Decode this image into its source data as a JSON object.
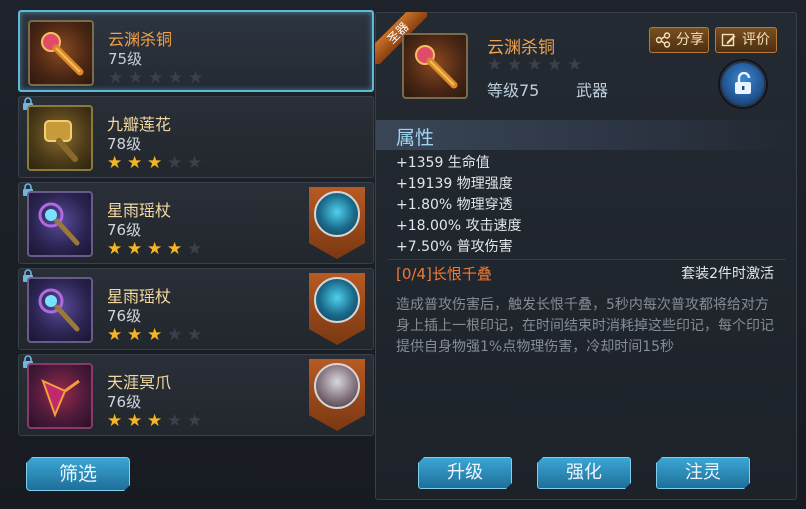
{
  "items": [
    {
      "name": "云渊杀铜",
      "level": "75级",
      "stars": 0,
      "selected": true,
      "badge": null
    },
    {
      "name": "九瓣莲花",
      "level": "78级",
      "stars": 3,
      "selected": false,
      "badge": null
    },
    {
      "name": "星雨瑶杖",
      "level": "76级",
      "stars": 4,
      "selected": false,
      "badge": "blue"
    },
    {
      "name": "星雨瑶杖",
      "level": "76级",
      "stars": 3,
      "selected": false,
      "badge": "blue"
    },
    {
      "name": "天涯冥爪",
      "level": "76级",
      "stars": 3,
      "selected": false,
      "badge": "ghost"
    }
  ],
  "filter_label": "筛选",
  "detail": {
    "ribbon": "圣器",
    "name": "云渊杀铜",
    "level": "等级75",
    "type": "武器",
    "share_label": "分享",
    "rate_label": "评价",
    "attr_title": "属性",
    "attributes": [
      "+1359 生命值",
      "+19139 物理强度",
      "+1.80% 物理穿透",
      "+18.00% 攻击速度",
      "+7.50% 普攻伤害"
    ],
    "set_name": "[0/4]长恨千叠",
    "set_activate": "套装2件时激活",
    "set_desc": "造成普攻伤害后，触发长恨千叠，5秒内每次普攻都将给对方身上插上一根印记，在时间结束时消耗掉这些印记，每个印记提供自身物强1%点物理伤害，冷却时间15秒"
  },
  "actions": {
    "upgrade": "升级",
    "enhance": "强化",
    "infuse": "注灵"
  },
  "colors": {
    "accent": "#3ba6d4",
    "star_on": "#f5b623",
    "item_name_selected": "#f4a14a",
    "set_name": "#f07a32"
  }
}
